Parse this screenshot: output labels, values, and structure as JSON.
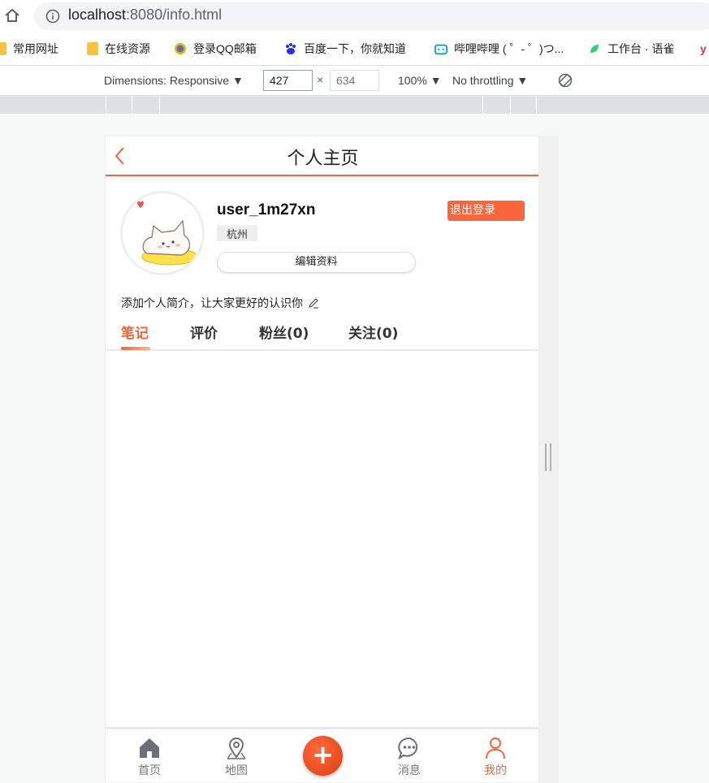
{
  "browser": {
    "url_host": "localhost",
    "url_rest": ":8080/info.html",
    "bookmarks": [
      {
        "label": "常用网址",
        "icon": "folder-icon"
      },
      {
        "label": "在线资源",
        "icon": "folder-icon"
      },
      {
        "label": "登录QQ邮箱",
        "icon": "qq-mail-icon"
      },
      {
        "label": "百度一下，你就知道",
        "icon": "baidu-icon"
      },
      {
        "label": "哔哩哔哩 ( ゜- ゜)つ...",
        "icon": "bilibili-icon"
      },
      {
        "label": "工作台 · 语雀",
        "icon": "yuque-icon"
      }
    ]
  },
  "devtools": {
    "dimensions_label": "Dimensions: Responsive ▼",
    "width": "427",
    "height_placeholder": "634",
    "times": "×",
    "zoom": "100% ▼",
    "throttling": "No throttling ▼"
  },
  "page": {
    "title": "个人主页",
    "username": "user_1m27xn",
    "city": "杭州",
    "edit_profile": "编辑资料",
    "logout": "退出登录",
    "bio": "添加个人简介，让大家更好的认识你",
    "tabs": [
      {
        "label": "笔记",
        "active": true
      },
      {
        "label": "评价",
        "active": false
      },
      {
        "label": "粉丝(0)",
        "active": false
      },
      {
        "label": "关注(0)",
        "active": false
      }
    ],
    "nav": [
      {
        "label": "首页",
        "icon": "home-icon"
      },
      {
        "label": "地图",
        "icon": "map-pin-icon"
      },
      {
        "label": "+",
        "icon": "add-icon"
      },
      {
        "label": "消息",
        "icon": "message-icon"
      },
      {
        "label": "我的",
        "icon": "user-icon",
        "active": true
      }
    ]
  },
  "colors": {
    "accent": "#f0653a",
    "logout_bg": "#f9663b"
  }
}
